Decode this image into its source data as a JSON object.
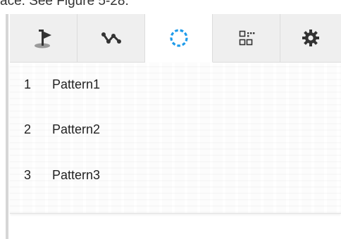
{
  "caption": "ace. See Figure 5-28.",
  "tabs": [
    {
      "icon": "flag-icon",
      "active": false
    },
    {
      "icon": "polyline-icon",
      "active": false
    },
    {
      "icon": "dotted-circle-icon",
      "active": true,
      "color": "#1e9bea"
    },
    {
      "icon": "grid-icon",
      "active": false
    },
    {
      "icon": "gear-icon",
      "active": false
    }
  ],
  "patterns": [
    {
      "num": "1",
      "label": "Pattern1"
    },
    {
      "num": "2",
      "label": "Pattern2"
    },
    {
      "num": "3",
      "label": "Pattern3"
    }
  ],
  "colors": {
    "accent": "#1e9bea",
    "icon": "#333333"
  }
}
